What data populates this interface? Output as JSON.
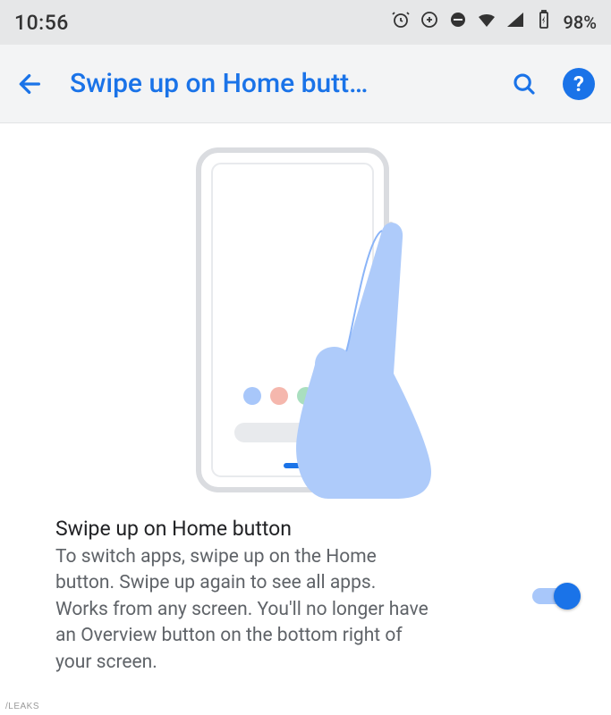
{
  "statusbar": {
    "time": "10:56",
    "battery": "98%"
  },
  "appbar": {
    "title": "Swipe up on Home butt…"
  },
  "setting": {
    "title": "Swipe up on Home button",
    "description": "To switch apps, swipe up on the Home button. Swipe up again to see all apps. Works from any screen. You'll no longer have an Overview button on the bottom right of your screen.",
    "toggle_on": true
  },
  "watermark": "/LEAKS"
}
